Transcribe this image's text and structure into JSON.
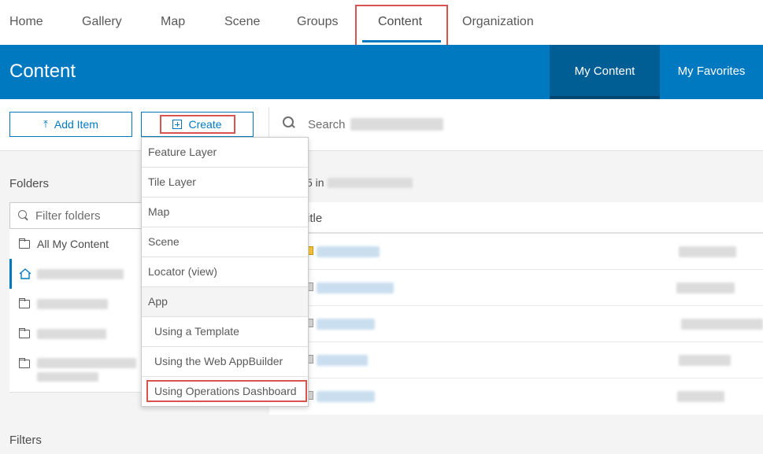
{
  "topnav": {
    "items": [
      {
        "label": "Home"
      },
      {
        "label": "Gallery"
      },
      {
        "label": "Map"
      },
      {
        "label": "Scene"
      },
      {
        "label": "Groups"
      },
      {
        "label": "Content"
      },
      {
        "label": "Organization"
      }
    ],
    "active": "Content"
  },
  "header": {
    "title": "Content",
    "tabs": [
      {
        "label": "My Content"
      },
      {
        "label": "My Favorites"
      }
    ]
  },
  "toolbar": {
    "add_item_label": "Add Item",
    "create_label": "Create",
    "search_label": "Search"
  },
  "sidebar": {
    "folders_label": "Folders",
    "filter_placeholder": "Filter folders",
    "all_content_label": "All My Content",
    "filters_label": "Filters"
  },
  "main": {
    "count_suffix": "5 in",
    "title_header": "itle"
  },
  "create_menu": {
    "items": [
      {
        "label": "Feature Layer"
      },
      {
        "label": "Tile Layer"
      },
      {
        "label": "Map"
      },
      {
        "label": "Scene"
      },
      {
        "label": "Locator (view)"
      },
      {
        "label": "App"
      },
      {
        "label": "Using a Template"
      },
      {
        "label": "Using the Web AppBuilder"
      },
      {
        "label": "Using Operations Dashboard"
      }
    ]
  },
  "colors": {
    "accent": "#0079c1",
    "highlight": "#d9534f"
  }
}
